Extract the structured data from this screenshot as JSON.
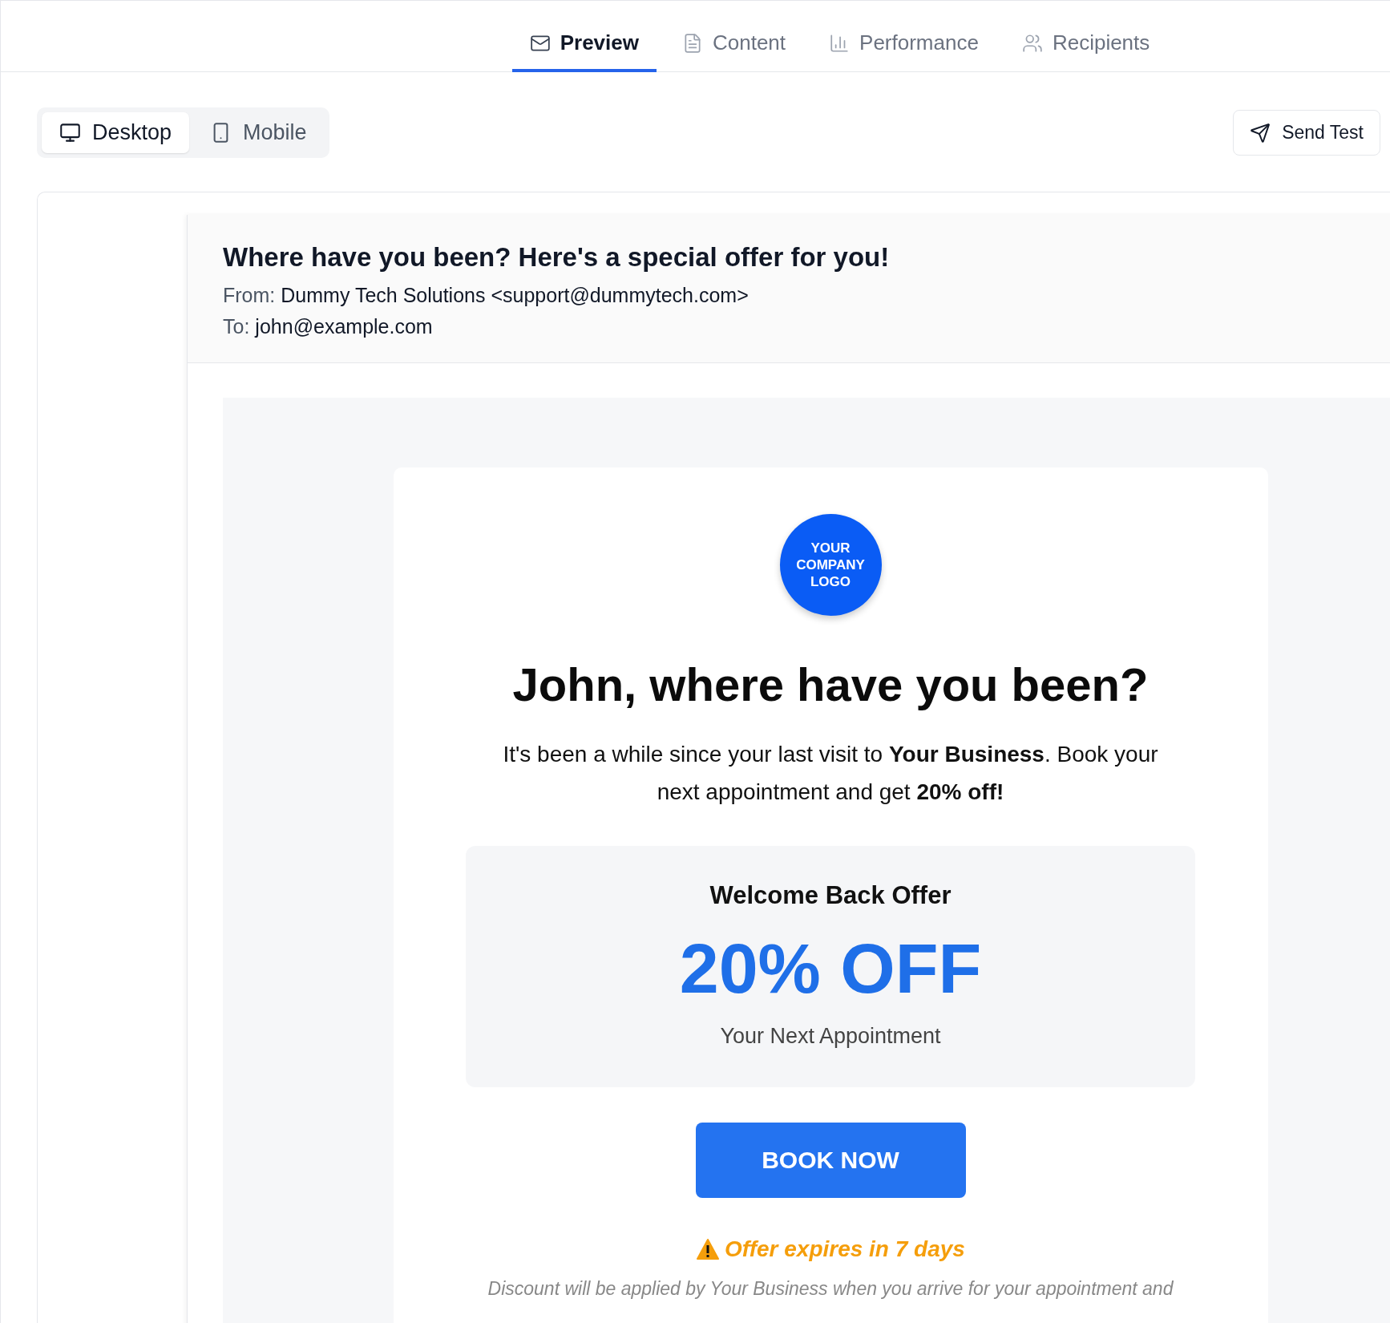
{
  "tabs": [
    {
      "label": "Preview",
      "selected": true
    },
    {
      "label": "Content",
      "selected": false
    },
    {
      "label": "Performance",
      "selected": false
    },
    {
      "label": "Recipients",
      "selected": false
    }
  ],
  "view_toggle": [
    {
      "label": "Desktop",
      "selected": true
    },
    {
      "label": "Mobile",
      "selected": false
    }
  ],
  "send_test_button": "Send Test",
  "email": {
    "subject": "Where have you been? Here's a special offer for you!",
    "from_label": "From:",
    "from": "Dummy Tech Solutions <support@dummytech.com>",
    "to_label": "To:",
    "to": "john@example.com",
    "logo": [
      "YOUR",
      "COMPANY",
      "LOGO"
    ],
    "headline": "John, where have you been?",
    "intro": "It's been a while since your last visit to **Your Business**. Book your next appointment and get **20% off!**",
    "offer": {
      "title": "Welcome Back Offer",
      "amount": "20% OFF",
      "subtitle": "Your Next Appointment"
    },
    "cta": "BOOK NOW",
    "warning": "Offer expires in 7 days",
    "disclaimer": "Discount will be applied by Your Business when you arrive for your appointment and"
  }
}
